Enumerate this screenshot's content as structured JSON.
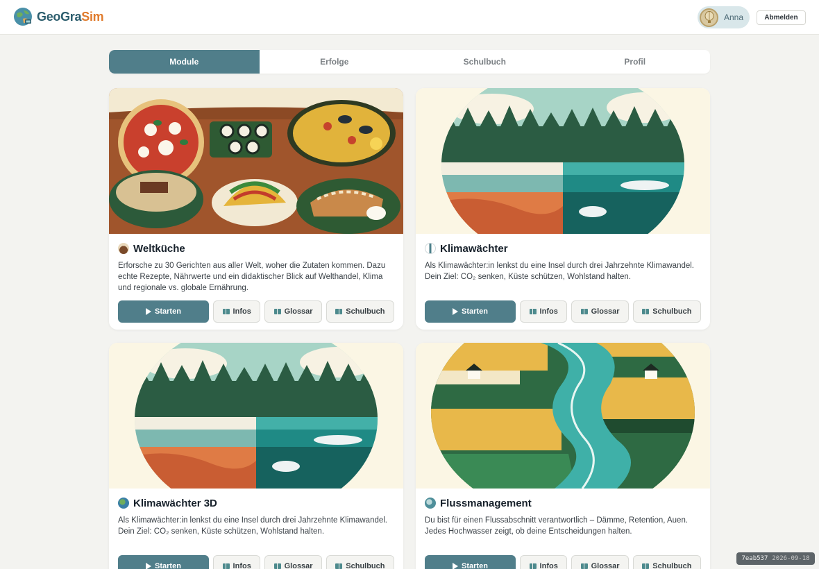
{
  "app": {
    "logo_part1": "Geo",
    "logo_part2": "Gra",
    "logo_part3": "Sim"
  },
  "user": {
    "name": "Anna",
    "logout_label": "Abmelden"
  },
  "tabs": [
    {
      "label": "Module",
      "active": true
    },
    {
      "label": "Erfolge",
      "active": false
    },
    {
      "label": "Schulbuch",
      "active": false
    },
    {
      "label": "Profil",
      "active": false
    }
  ],
  "modules": [
    {
      "icon": "food-bowl-icon",
      "title": "Weltküche",
      "description": "Erforsche zu 30 Gerichten aus aller Welt, woher die Zutaten kommen. Dazu echte Rezepte, Nährwerte und ein didaktischer Blick auf Welthandel, Klima und regionale vs. globale Ernährung.",
      "image": "world-dishes-illustration"
    },
    {
      "icon": "thermometer-icon",
      "title": "Klimawächter",
      "description": "Als Klimawächter:in lenkst du eine Insel durch drei Jahrzehnte Klimawandel. Dein Ziel: CO₂ senken, Küste schützen, Wohlstand halten.",
      "image": "island-climate-illustration"
    },
    {
      "icon": "globe-icon",
      "title": "Klimawächter 3D",
      "description": "Als Klimawächter:in lenkst du eine Insel durch drei Jahrzehnte Klimawandel. Dein Ziel: CO₂ senken, Küste schützen, Wohlstand halten.",
      "image": "island-climate-illustration"
    },
    {
      "icon": "globe-water-icon",
      "title": "Flussmanagement",
      "description": "Du bist für einen Flussabschnitt verantwortlich – Dämme, Retention, Auen. Jedes Hochwasser zeigt, ob deine Entscheidungen halten.",
      "image": "river-landscape-illustration"
    }
  ],
  "buttons": {
    "start": "Starten",
    "info": "Infos",
    "glossar": "Glossar",
    "schulbuch": "Schulbuch"
  },
  "version": {
    "hash": "7eab537",
    "date": "2026-09-18"
  },
  "colors": {
    "primary": "#507e8a",
    "accent": "#e07b2c",
    "background": "#f3f3f0"
  }
}
